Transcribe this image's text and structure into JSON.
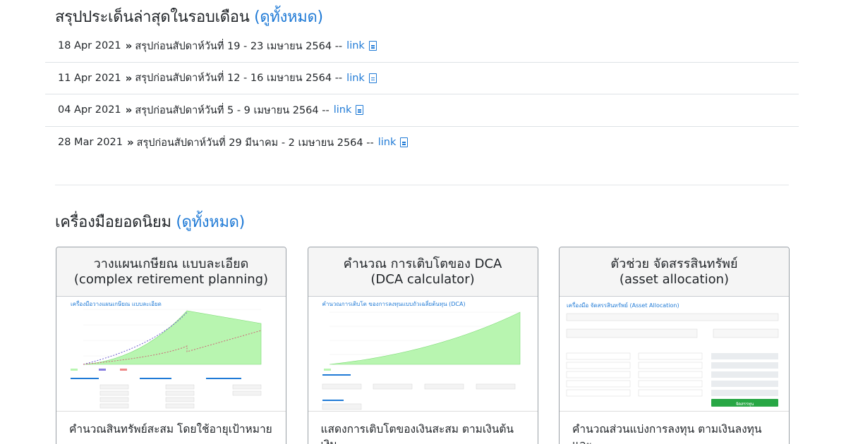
{
  "news_section": {
    "title": "สรุปประเด็นล่าสุดในรอบเดือน",
    "see_all": "(ดูทั้งหมด)",
    "items": [
      {
        "date": "18 Apr 2021",
        "text": "สรุปก่อนสัปดาห์วันที่ 19 - 23 เมษายน 2564 --",
        "link": "link"
      },
      {
        "date": "11 Apr 2021",
        "text": "สรุปก่อนสัปดาห์วันที่ 12 - 16 เมษายน 2564 --",
        "link": "link"
      },
      {
        "date": "04 Apr 2021",
        "text": "สรุปก่อนสัปดาห์วันที่ 5 - 9 เมษายน 2564 --",
        "link": "link"
      },
      {
        "date": "28 Mar 2021",
        "text": "สรุปก่อนสัปดาห์วันที่ 29 มีนาคม - 2 เมษายน 2564 --",
        "link": "link"
      }
    ]
  },
  "tools_section": {
    "title": "เครื่องมือยอดนิยม",
    "see_all": "(ดูทั้งหมด)",
    "cards": [
      {
        "title_th": "วางแผนเกษียณ แบบละเอียด",
        "title_en": "(complex retirement planning)",
        "thumb_title": "เครื่องมือวางแผนเกษียณ แบบละเอียด",
        "body": "คำนวณสินทรัพย์สะสม โดยใช้อายุเป้าหมาย"
      },
      {
        "title_th": "คำนวณ การเติบโตของ DCA",
        "title_en": "(DCA calculator)",
        "thumb_title": "คำนวณการเติบโต ของการลงทุนแบบถัวเฉลี่ยต้นทุน (DCA)",
        "body": "แสดงการเติบโตของเงินสะสม ตามเงินต้น เงิน"
      },
      {
        "title_th": "ตัวช่วย จัดสรรสินทรัพย์",
        "title_en": "(asset allocation)",
        "thumb_title": "เครื่องมือ จัดสรรสินทรัพย์ (Asset Allocation)",
        "thumb_button": "จัดสรรทุน",
        "body": "คำนวณส่วนแบ่งการลงทุน ตามเงินลงทุน และ"
      }
    ]
  },
  "colors": {
    "link": "#1f7ad6",
    "chart_fill": "#b8f5b0",
    "button_green": "#28a745"
  }
}
